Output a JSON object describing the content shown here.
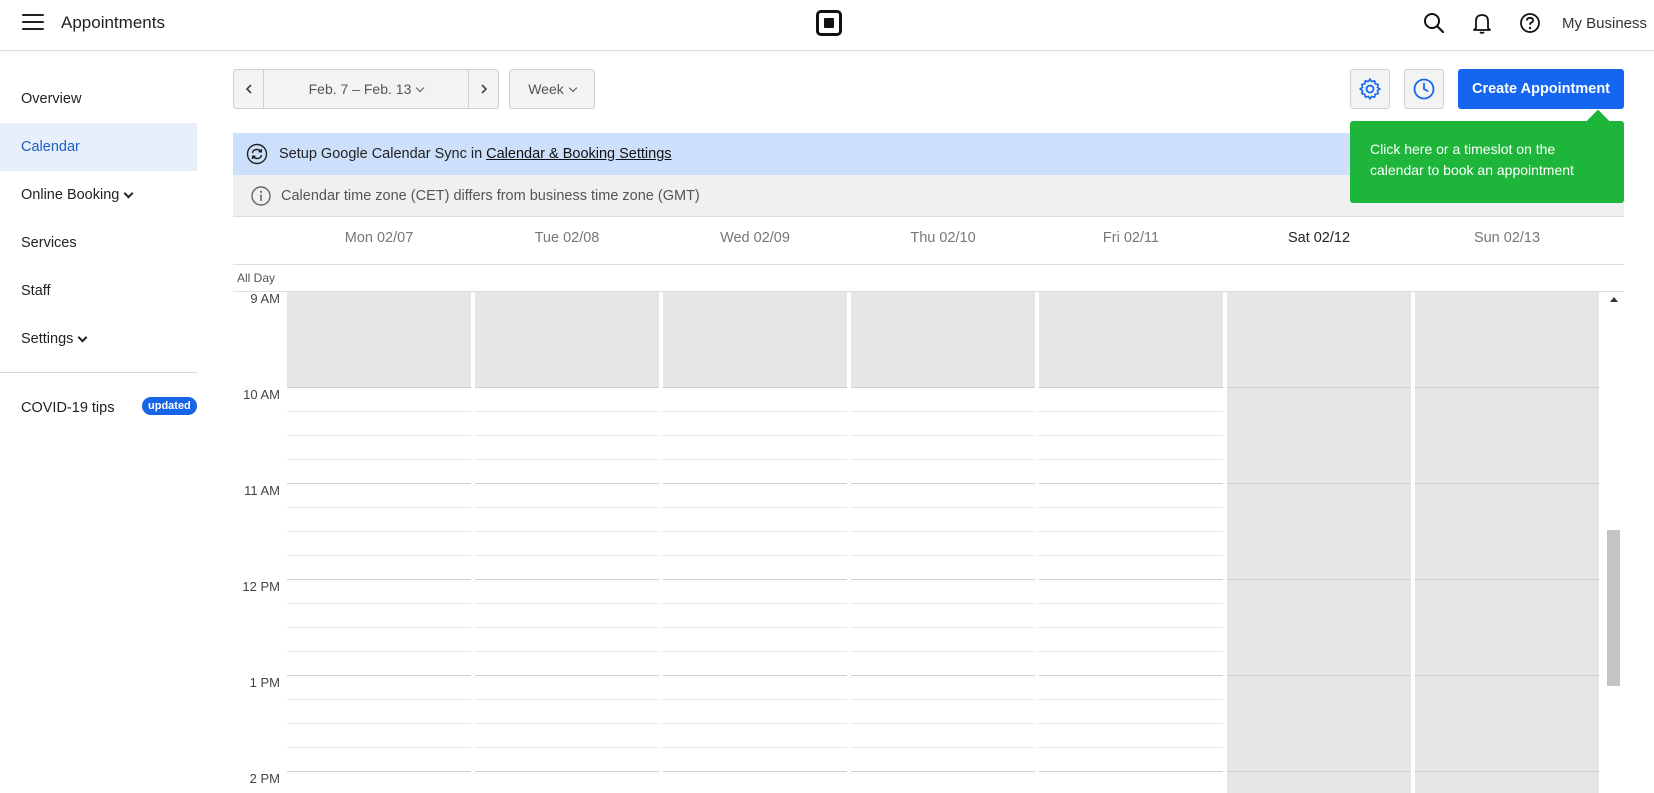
{
  "header": {
    "app_title": "Appointments",
    "business_name": "My Business",
    "icons": [
      "menu-icon",
      "square-logo",
      "search-icon",
      "bell-icon",
      "help-icon"
    ]
  },
  "sidebar": {
    "items": [
      {
        "label": "Overview"
      },
      {
        "label": "Calendar",
        "active": true
      },
      {
        "label": "Online Booking"
      },
      {
        "label": "Services"
      },
      {
        "label": "Staff"
      },
      {
        "label": "Settings"
      }
    ],
    "covid": {
      "label": "COVID-19 tips",
      "badge": "updated"
    }
  },
  "toolbar": {
    "date_range": "Feb. 7 – Feb. 13",
    "view": "Week",
    "create_label": "Create Appointment"
  },
  "tooltip": {
    "text": "Click here or a timeslot on the calendar to book an appointment"
  },
  "banners": {
    "sync_prefix": "Setup Google Calendar Sync in",
    "sync_link": "Calendar & Booking Settings",
    "timezone": "Calendar time zone (CET) differs from business time zone (GMT)"
  },
  "calendar": {
    "all_day_label": "All Day",
    "days": [
      {
        "label": "Mon 02/07"
      },
      {
        "label": "Tue 02/08"
      },
      {
        "label": "Wed 02/09"
      },
      {
        "label": "Thu 02/10"
      },
      {
        "label": "Fri 02/11"
      },
      {
        "label": "Sat 02/12",
        "today": true
      },
      {
        "label": "Sun 02/13"
      }
    ],
    "hours": [
      "9 AM",
      "10 AM",
      "11 AM",
      "12 PM",
      "1 PM",
      "2 PM"
    ]
  },
  "colors": {
    "accent": "#1466f0",
    "tooltip_green": "#1db53a",
    "closed_shade": "#e6e6e6",
    "sync_banner": "#cde0fb"
  }
}
